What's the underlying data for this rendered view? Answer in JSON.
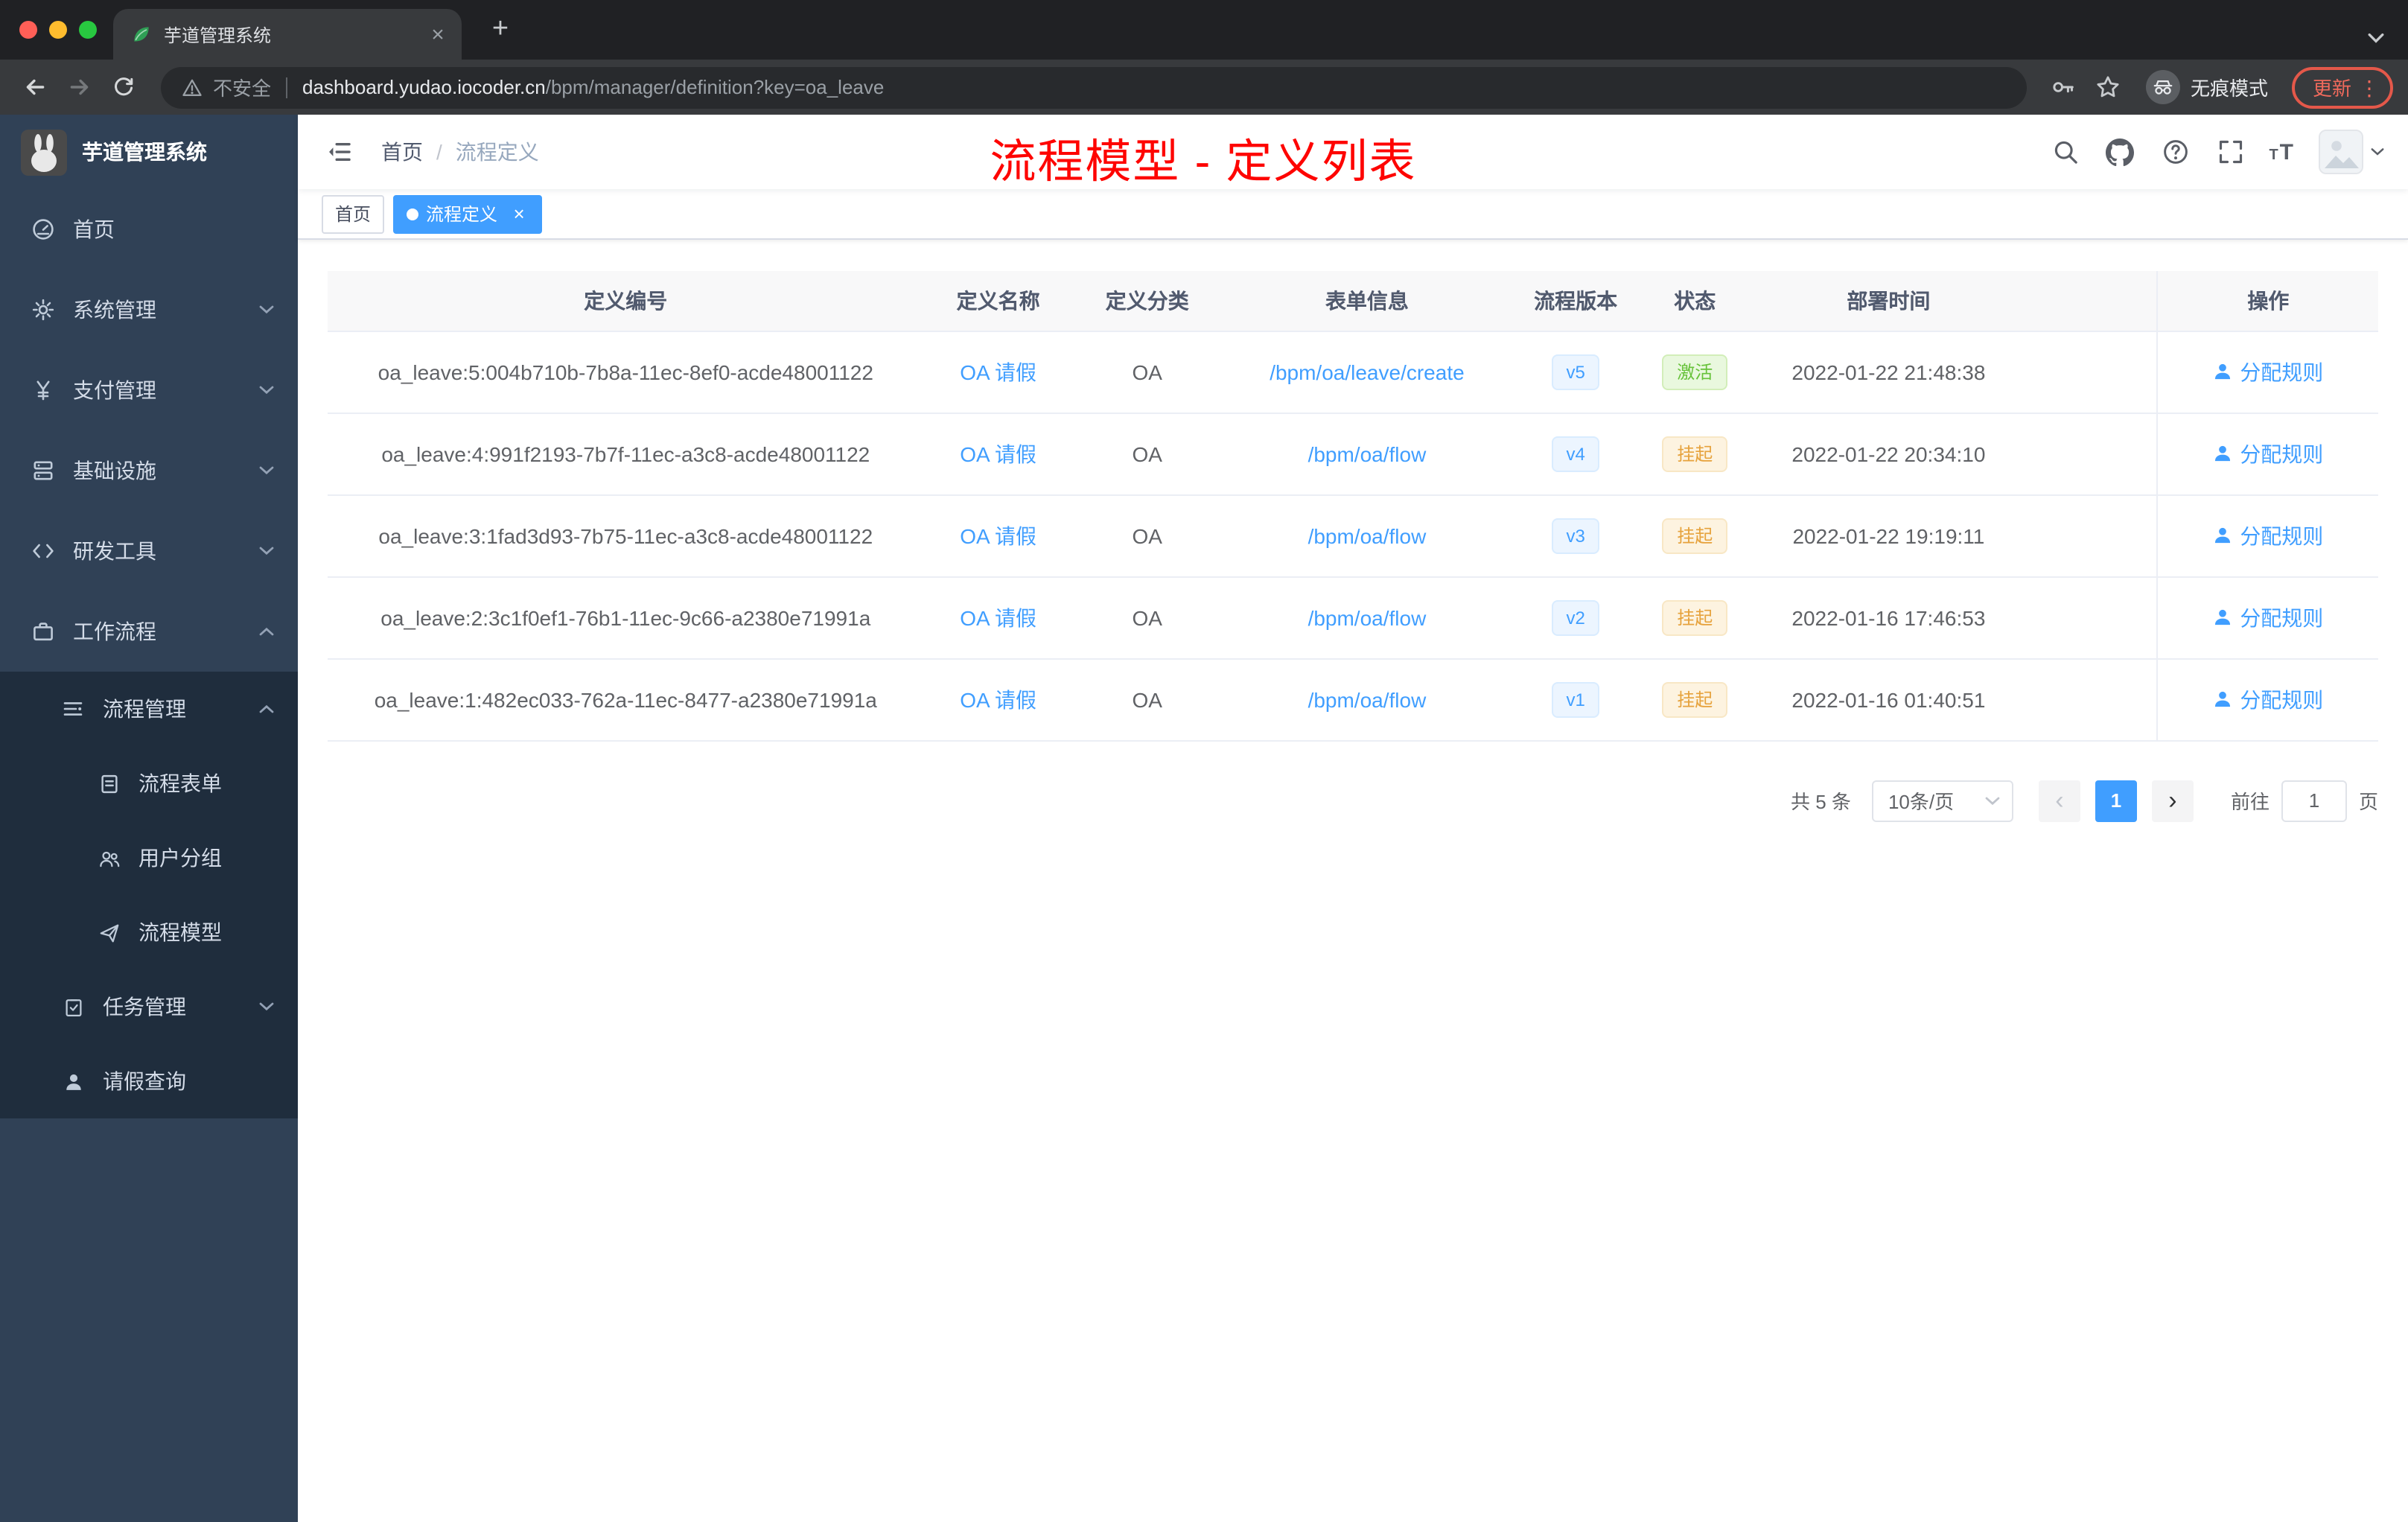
{
  "colors": {
    "accent_blue": "#409eff",
    "annotation_red": "#fe0400",
    "status_active_green": "#67c23a",
    "status_suspended_orange": "#e6a23c",
    "sidebar_bg": "#304156",
    "sidebar_submenu_bg": "#1f2d3d",
    "update_badge_red": "#e4584a"
  },
  "browser": {
    "tab_title": "芋道管理系统",
    "security_label": "不安全",
    "url_host": "dashboard.yudao.iocoder.cn",
    "url_path": "/bpm/manager/definition?key=oa_leave",
    "incognito_label": "无痕模式",
    "update_label": "更新",
    "kebab_glyph": "⋮",
    "new_tab_glyph": "+",
    "close_tab_glyph": "×"
  },
  "sidebar": {
    "logo_title": "芋道管理系统",
    "menu": [
      {
        "label": "首页",
        "icon": "dashboard-icon"
      },
      {
        "label": "系统管理",
        "icon": "gear-icon",
        "chevron": "down"
      },
      {
        "label": "支付管理",
        "icon": "yen-icon",
        "chevron": "down"
      },
      {
        "label": "基础设施",
        "icon": "infrastructure-icon",
        "chevron": "down"
      },
      {
        "label": "研发工具",
        "icon": "devtools-icon",
        "chevron": "down"
      },
      {
        "label": "工作流程",
        "icon": "workflow-icon",
        "chevron": "up"
      },
      {
        "label": "流程管理",
        "icon": "process-manage-icon",
        "chevron": "up"
      },
      {
        "label": "流程表单",
        "icon": "form-icon"
      },
      {
        "label": "用户分组",
        "icon": "user-group-icon"
      },
      {
        "label": "流程模型",
        "icon": "process-model-icon"
      },
      {
        "label": "任务管理",
        "icon": "task-manage-icon",
        "chevron": "down"
      },
      {
        "label": "请假查询",
        "icon": "person-icon"
      }
    ]
  },
  "header": {
    "breadcrumb_root": "首页",
    "breadcrumb_separator": "/",
    "breadcrumb_current": "流程定义",
    "annotation": "流程模型 - 定义列表",
    "icons": [
      "search-icon",
      "github-icon",
      "help-icon",
      "fullscreen-icon",
      "font-size-icon",
      "avatar",
      "caret-down-icon"
    ]
  },
  "tags": {
    "home_tag": "首页",
    "active_tag": "流程定义",
    "close_glyph": "×"
  },
  "table": {
    "columns": [
      "定义编号",
      "定义名称",
      "定义分类",
      "表单信息",
      "流程版本",
      "状态",
      "部署时间",
      "操作"
    ],
    "rows": [
      {
        "id": "oa_leave:5:004b710b-7b8a-11ec-8ef0-acde48001122",
        "name": "OA 请假",
        "category": "OA",
        "form": "/bpm/oa/leave/create",
        "version": "v5",
        "status": "激活",
        "time": "2022-01-22 21:48:38",
        "action": "分配规则"
      },
      {
        "id": "oa_leave:4:991f2193-7b7f-11ec-a3c8-acde48001122",
        "name": "OA 请假",
        "category": "OA",
        "form": "/bpm/oa/flow",
        "version": "v4",
        "status": "挂起",
        "time": "2022-01-22 20:34:10",
        "action": "分配规则"
      },
      {
        "id": "oa_leave:3:1fad3d93-7b75-11ec-a3c8-acde48001122",
        "name": "OA 请假",
        "category": "OA",
        "form": "/bpm/oa/flow",
        "version": "v3",
        "status": "挂起",
        "time": "2022-01-22 19:19:11",
        "action": "分配规则"
      },
      {
        "id": "oa_leave:2:3c1f0ef1-76b1-11ec-9c66-a2380e71991a",
        "name": "OA 请假",
        "category": "OA",
        "form": "/bpm/oa/flow",
        "version": "v2",
        "status": "挂起",
        "time": "2022-01-16 17:46:53",
        "action": "分配规则"
      },
      {
        "id": "oa_leave:1:482ec033-762a-11ec-8477-a2380e71991a",
        "name": "OA 请假",
        "category": "OA",
        "form": "/bpm/oa/flow",
        "version": "v1",
        "status": "挂起",
        "time": "2022-01-16 01:40:51",
        "action": "分配规则"
      }
    ]
  },
  "pagination": {
    "total": "共 5 条",
    "page_size": "10条/页",
    "current_page": "1",
    "prev_glyph": "‹",
    "next_glyph": "›",
    "goto_label": "前往",
    "goto_value": "1",
    "unit_label": "页"
  }
}
